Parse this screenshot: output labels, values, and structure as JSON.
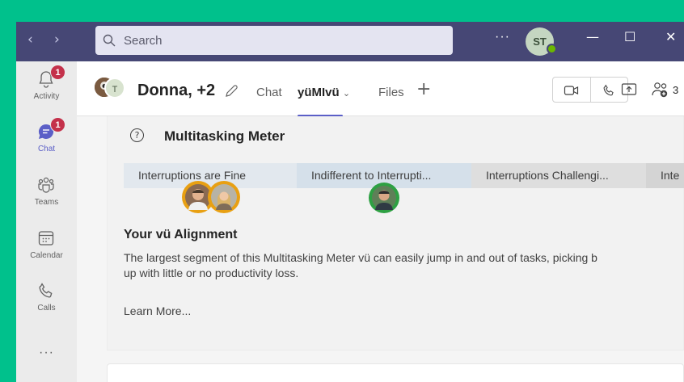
{
  "titlebar": {
    "back_glyph": "‹",
    "forward_glyph": "›",
    "search_placeholder": "Search",
    "more_glyph": "···",
    "user_initials": "ST",
    "minimize_glyph": "—",
    "maximize_glyph": "☐",
    "close_glyph": "✕"
  },
  "rail": {
    "items": [
      {
        "label": "Activity",
        "icon": "bell-icon",
        "badge": "1"
      },
      {
        "label": "Chat",
        "icon": "chat-icon",
        "badge": "1"
      },
      {
        "label": "Teams",
        "icon": "teams-icon"
      },
      {
        "label": "Calendar",
        "icon": "calendar-icon"
      },
      {
        "label": "Calls",
        "icon": "phone-icon"
      }
    ],
    "more_glyph": "···"
  },
  "header": {
    "avatar_initial": "T",
    "title": "Donna, +2",
    "tabs": [
      {
        "label": "Chat"
      },
      {
        "label": "yüMIvü",
        "chevron": "⌄"
      },
      {
        "label": "Files"
      }
    ],
    "add_tab_glyph": "+",
    "participants_count": "3"
  },
  "meter": {
    "title": "Multitasking Meter",
    "help_glyph": "?",
    "segments": [
      {
        "label": "Interruptions are Fine",
        "color": "#e2e8ee"
      },
      {
        "label": "Indifferent to Interrupti...",
        "color": "#d5e0ea"
      },
      {
        "label": "Interruptions Challengi...",
        "color": "#dedede"
      },
      {
        "label": "Inte",
        "color": "#d4d4d4"
      }
    ]
  },
  "alignment": {
    "title": "Your vü Alignment",
    "line1": "The largest segment of this Multitasking Meter vü can easily jump in and out of tasks, picking b",
    "line2": "up with little or no productivity loss.",
    "learn_more": "Learn More..."
  },
  "colors": {
    "titlebar": "#464775",
    "accent": "#5b5fc7",
    "badge": "#c4314b",
    "available": "#6bb700",
    "ring_orange": "#e8a013",
    "ring_green": "#2ea043"
  }
}
